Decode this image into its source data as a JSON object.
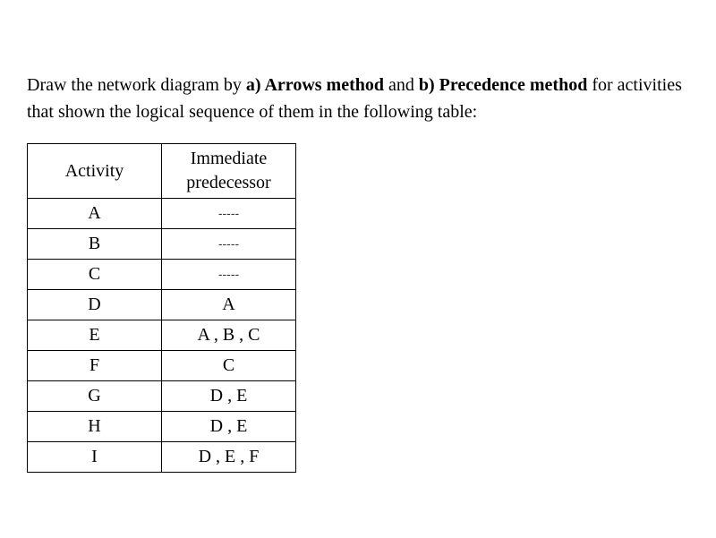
{
  "question": {
    "prefix": "Draw the network diagram by ",
    "part_a_label": "a) Arrows method",
    "mid": " and ",
    "part_b_label": "b) Precedence method",
    "suffix": " for activities that shown the logical sequence of them in the following table:"
  },
  "table": {
    "header": {
      "activity": "Activity",
      "predecessor_line1": "Immediate",
      "predecessor_line2": "predecessor"
    },
    "rows": [
      {
        "activity": "A",
        "predecessor": "-----",
        "dash": true
      },
      {
        "activity": "B",
        "predecessor": "-----",
        "dash": true
      },
      {
        "activity": "C",
        "predecessor": "-----",
        "dash": true
      },
      {
        "activity": "D",
        "predecessor": "A",
        "dash": false
      },
      {
        "activity": "E",
        "predecessor": "A , B , C",
        "dash": false
      },
      {
        "activity": "F",
        "predecessor": "C",
        "dash": false
      },
      {
        "activity": "G",
        "predecessor": "D , E",
        "dash": false
      },
      {
        "activity": "H",
        "predecessor": "D , E",
        "dash": false
      },
      {
        "activity": "I",
        "predecessor": "D , E , F",
        "dash": false
      }
    ]
  }
}
